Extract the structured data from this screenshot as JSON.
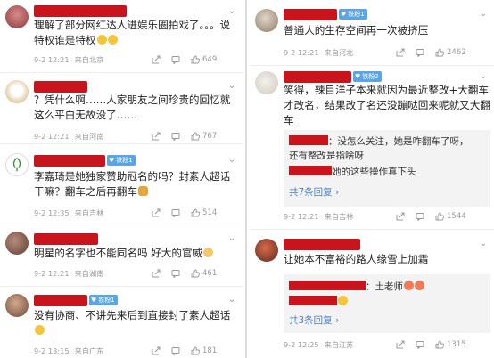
{
  "left": [
    {
      "text": "理解了部分网红达人进娱乐圈拍戏了。。。说特权谁是特权",
      "emojis": [
        "😊",
        "😊"
      ],
      "time": "9-2 12:21",
      "source": "来自北京",
      "likes": "649",
      "badge": ""
    },
    {
      "text": "？凭什么啊……人家朋友之间珍贵的回忆就这么平白无故没了……",
      "time": "9-2 12:21",
      "source": "来自河南",
      "likes": "767",
      "badge": ""
    },
    {
      "text": "李嘉琦是她独家赞助冠名的吗？封素人超话干嘛？翻车之后再翻车",
      "emojis": [
        "🍔"
      ],
      "time": "9-2 12:35",
      "source": "来自吉林",
      "likes": "514",
      "badge": "铁粉1"
    },
    {
      "text": "明星的名字也不能同名吗 好大的官威",
      "emojis": [
        "😵"
      ],
      "time": "9-2 12:21",
      "source": "来自湖南",
      "likes": "461",
      "badge": ""
    },
    {
      "text": "没有协商、不讲先来后到直接封了素人超话",
      "emojis": [
        "😭"
      ],
      "time": "9-2 13:15",
      "source": "来自广东",
      "likes": "181",
      "badge": "铁粉1"
    }
  ],
  "right": [
    {
      "text": "普通人的生存空间再一次被挤压",
      "time": "9-2 12:21",
      "source": "来自河北",
      "likes": "2462",
      "badge": "铁粉1"
    },
    {
      "text": "笑得，辣目洋子本来就因为最近整改+大翻车才改名，结果改了名还没蹦哒回来呢就又大翻车",
      "reply_lines": [
        "：没怎么关注，她是咋翻车了呀，",
        "还有整改是指啥呀",
        "她的这些操作真下头"
      ],
      "more_replies": "共7条回复 ›",
      "time": "9-2 12:21",
      "source": "来自吉林",
      "likes": "1544",
      "badge": "铁粉2"
    },
    {
      "text": "让她本不富裕的路人缘雪上加霜",
      "reply_lines": [
        "：土老师"
      ],
      "more_replies": "共3条回复 ›",
      "time": "9-2 12:25",
      "source": "来自江苏",
      "likes": "1315",
      "badge": ""
    }
  ],
  "icons": {
    "share": "share-icon",
    "comment": "comment-icon",
    "like": "like-icon",
    "more": "chevron-down-icon"
  },
  "colors": {
    "redact": "#c8141d",
    "badge": "#5aa5e6",
    "link": "#4a7fb5"
  }
}
